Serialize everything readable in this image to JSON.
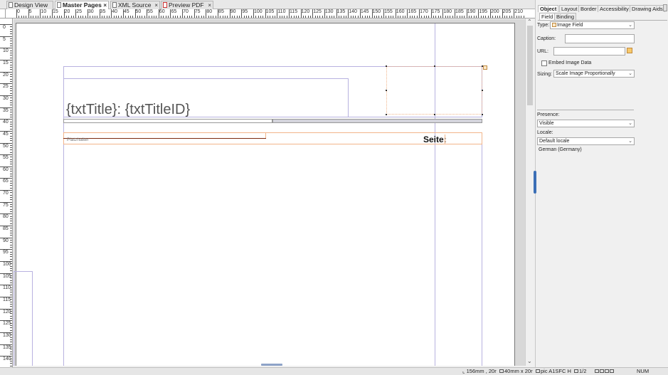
{
  "tabs": [
    {
      "label": "Design View",
      "active": false
    },
    {
      "label": "Master Pages",
      "active": true
    },
    {
      "label": "XML Source",
      "active": false
    },
    {
      "label": "Preview PDF",
      "active": false
    }
  ],
  "ruler_top_labels": [
    "0",
    "5",
    "10",
    "15",
    "20",
    "25",
    "30",
    "35",
    "40",
    "45",
    "50",
    "55",
    "60",
    "65",
    "70",
    "75",
    "80",
    "85",
    "90",
    "95",
    "100",
    "105",
    "110",
    "115",
    "120",
    "125",
    "130",
    "135",
    "140",
    "145",
    "150",
    "155",
    "160",
    "165",
    "170",
    "175",
    "180",
    "185",
    "190",
    "195",
    "200",
    "205",
    "210"
  ],
  "ruler_left_labels": [
    "0",
    "5",
    "10",
    "15",
    "20",
    "25",
    "30",
    "35",
    "40",
    "45",
    "50",
    "55",
    "60",
    "65",
    "70",
    "75",
    "80",
    "85",
    "90",
    "95",
    "100",
    "105",
    "110",
    "115",
    "120",
    "125",
    "130",
    "135",
    "140"
  ],
  "canvas": {
    "title_text": "{txtTitle}:  {txtTitleID}",
    "placeholder_text": "Platzhalter",
    "seite_text": "Seite:"
  },
  "panel": {
    "tabs": [
      "Object",
      "Layout",
      "Border",
      "Accessibility",
      "Drawing Aids"
    ],
    "subtabs": [
      "Field",
      "Binding"
    ],
    "type_label": "Type:",
    "type_value": "Image Field",
    "caption_label": "Caption:",
    "caption_value": "",
    "url_label": "URL:",
    "url_value": "",
    "embed_label": "Embed Image Data",
    "embed_checked": false,
    "sizing_label": "Sizing:",
    "sizing_value": "Scale Image Proportionally",
    "presence_label": "Presence:",
    "presence_value": "Visible",
    "locale_label": "Locale:",
    "locale_value": "Default locale",
    "locale_hint": "German (Germany)"
  },
  "status": {
    "position": "156mm , 20r",
    "size": "40mm x 20r",
    "object": "pic A1SFC H",
    "page": "1/2",
    "num": "NUM"
  },
  "colors": {
    "guide": "#b8b2e0",
    "selection": "#f2b58a",
    "accent": "#3b6fb6"
  }
}
